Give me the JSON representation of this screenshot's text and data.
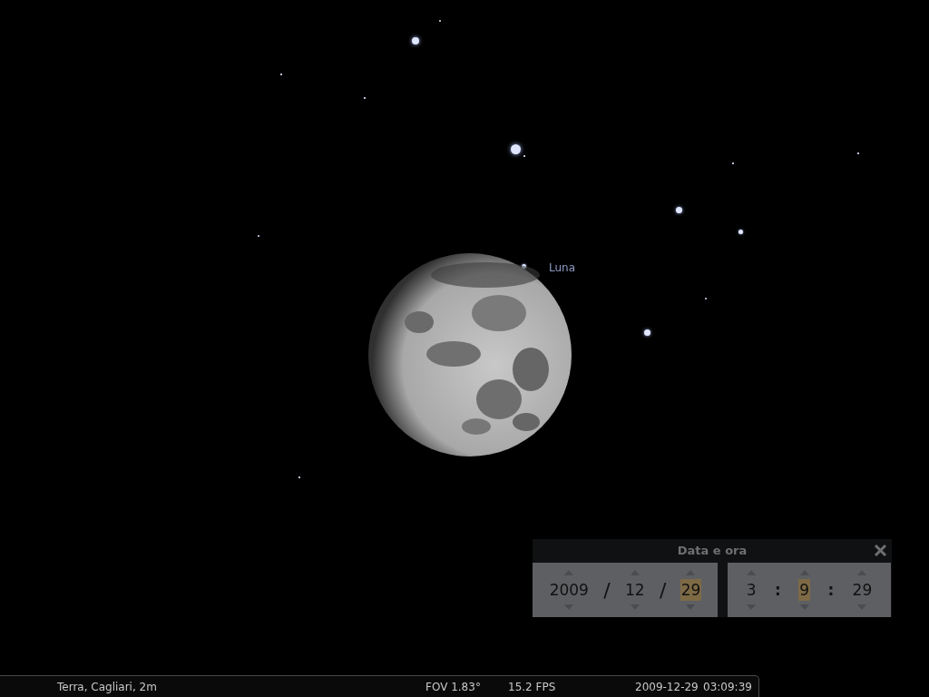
{
  "sky": {
    "object_label": "Luna"
  },
  "date_dialog": {
    "title": "Data e ora",
    "date_items": [
      {
        "kind": "spin",
        "value": "2009",
        "selected": false
      },
      {
        "kind": "separator",
        "value": "/"
      },
      {
        "kind": "spin",
        "value": "12",
        "selected": false
      },
      {
        "kind": "separator",
        "value": "/"
      },
      {
        "kind": "spin",
        "value": "29",
        "selected": true
      }
    ],
    "time_items": [
      {
        "kind": "spin",
        "value": "3",
        "selected": false
      },
      {
        "kind": "separator",
        "value": ":"
      },
      {
        "kind": "spin",
        "value": "9",
        "selected": true
      },
      {
        "kind": "separator",
        "value": ":"
      },
      {
        "kind": "spin",
        "value": "29",
        "selected": false
      }
    ]
  },
  "status_bar": {
    "location": "Terra, Cagliari, 2m",
    "fov": "FOV 1.83°",
    "fps": "15.2 FPS",
    "date": "2009-12-29",
    "time": "03:09:39"
  }
}
